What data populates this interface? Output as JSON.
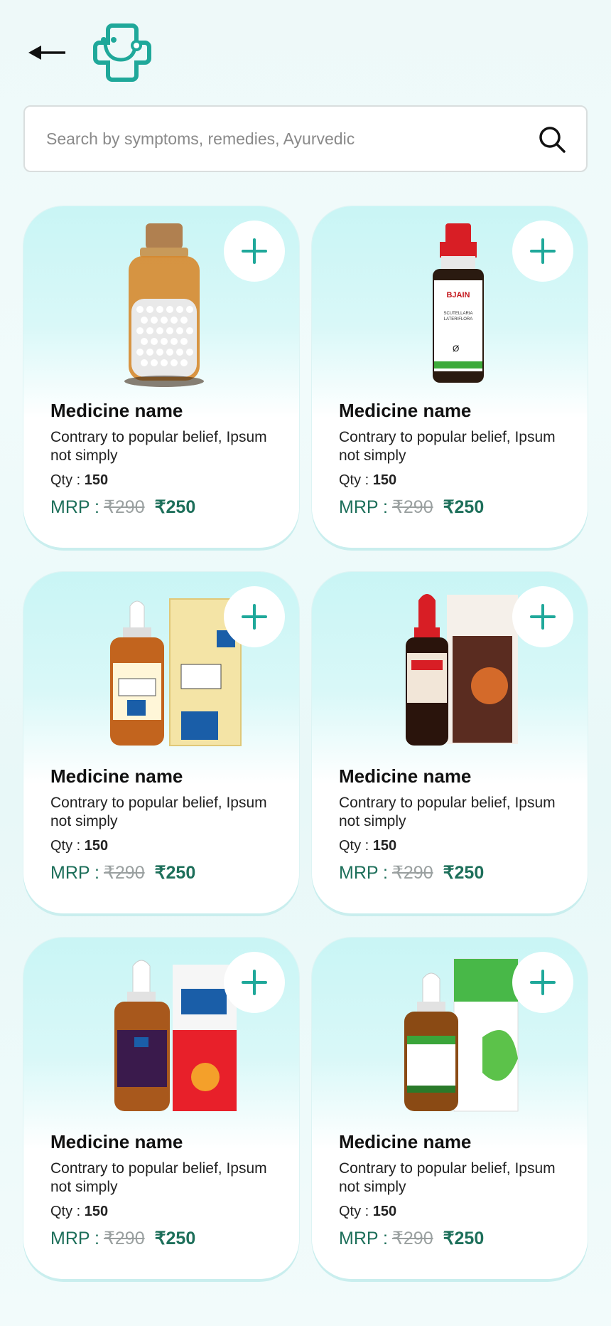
{
  "header": {
    "back_icon": "arrow-left-icon",
    "logo_icon": "medical-cross-stethoscope-logo"
  },
  "search": {
    "placeholder": "Search by symptoms, remedies, Ayurvedic",
    "value": "",
    "icon": "search-icon"
  },
  "colors": {
    "accent": "#1fa89a",
    "price": "#1d6f5a",
    "card_top": "#c9f5f5"
  },
  "products": [
    {
      "name": "Medicine name",
      "description": "Contrary to popular belief, Ipsum not simply",
      "qty_label": "Qty :",
      "qty": "150",
      "mrp_label": "MRP :",
      "old_price": "₹290",
      "new_price": "₹250",
      "image": "amber-glass-pill-jar"
    },
    {
      "name": "Medicine name",
      "description": "Contrary to popular belief, Ipsum not simply",
      "qty_label": "Qty :",
      "qty": "150",
      "mrp_label": "MRP :",
      "old_price": "₹290",
      "new_price": "₹250",
      "image": "red-cap-tincture-bottle"
    },
    {
      "name": "Medicine name",
      "description": "Contrary to popular belief, Ipsum not simply",
      "qty_label": "Qty :",
      "qty": "150",
      "mrp_label": "MRP :",
      "old_price": "₹290",
      "new_price": "₹250",
      "image": "ghr-bottle-with-box"
    },
    {
      "name": "Medicine name",
      "description": "Contrary to popular belief, Ipsum not simply",
      "qty_label": "Qty :",
      "qty": "150",
      "mrp_label": "MRP :",
      "old_price": "₹290",
      "new_price": "₹250",
      "image": "ruck-pain-bottle-with-box"
    },
    {
      "name": "Medicine name",
      "description": "Contrary to popular belief, Ipsum not simply",
      "qty_label": "Qty :",
      "qty": "150",
      "mrp_label": "MRP :",
      "old_price": "₹290",
      "new_price": "₹250",
      "image": "feverem-bottle-with-box"
    },
    {
      "name": "Medicine name",
      "description": "Contrary to popular belief, Ipsum not simply",
      "qty_label": "Qty :",
      "qty": "150",
      "mrp_label": "MRP :",
      "old_price": "₹290",
      "new_price": "₹250",
      "image": "adven-bottle-with-box"
    }
  ]
}
